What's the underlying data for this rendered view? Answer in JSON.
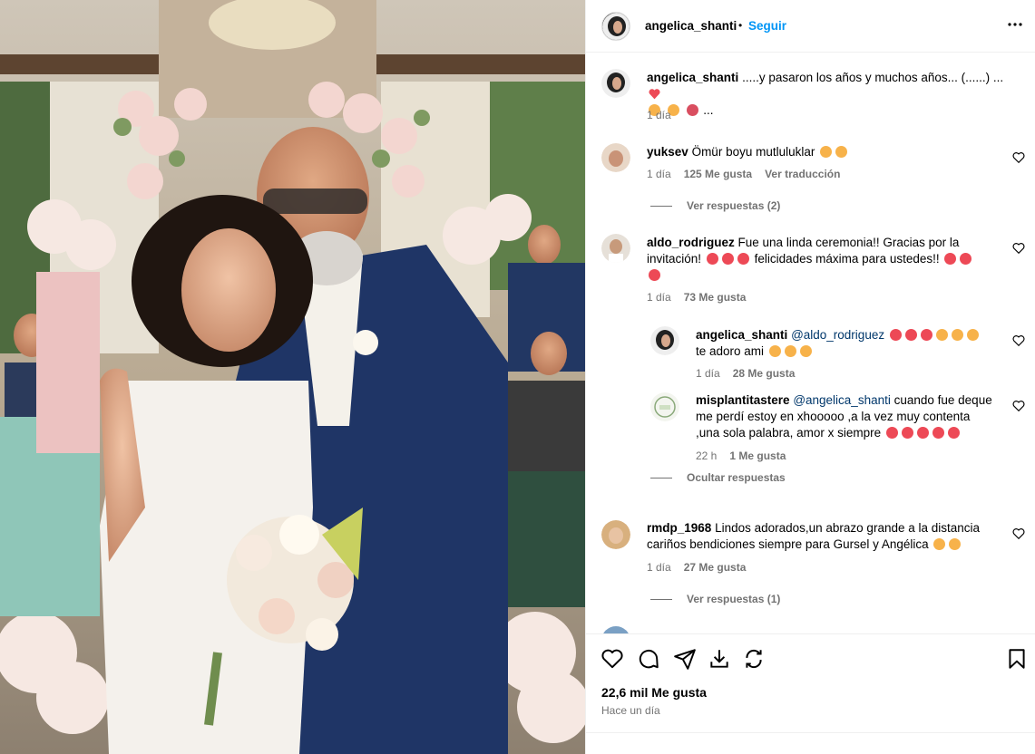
{
  "post": {
    "username": "angelica_shanti",
    "follow_label": "Seguir",
    "separator": "•",
    "more_label": "•••"
  },
  "caption": {
    "username": "angelica_shanti",
    "text": ".....y pasaron los años y muchos años... (......) ...",
    "time": "1 día"
  },
  "comments": [
    {
      "username": "yuksev",
      "text": "Ömür boyu mutluluklar",
      "time": "1 día",
      "likes": "125 Me gusta",
      "translate": "Ver traducción",
      "replies": "Ver respuestas (2)"
    },
    {
      "username": "aldo_rodriguez",
      "text_line1": "Fue una linda ceremonia!! Gracias por la",
      "text_line2": "invitación!",
      "text_line2b": "felicidades máxima para ustedes!!",
      "time": "1 día",
      "likes": "73 Me gusta"
    },
    {
      "username": "angelica_shanti",
      "mention": "@aldo_rodriguez",
      "text_line2": "te adoro ami",
      "time": "1 día",
      "likes": "28 Me gusta"
    },
    {
      "username": "misplantitastere",
      "mention": "@angelica_shanti",
      "text_line1": "cuando fue deque",
      "text_line2": "me perdí estoy en xhooooo ,a la vez muy contenta",
      "text_line3": ",una sola palabra, amor x siempre",
      "time": "22 h",
      "likes": "1 Me gusta",
      "hide": "Ocultar respuestas"
    },
    {
      "username": "rmdp_1968",
      "text_line1": "Lindos adorados,un abrazo grande a la distancia",
      "text_line2": "cariños bendiciones siempre para Gursel y Angélica",
      "time": "1 día",
      "likes": "27 Me gusta",
      "replies": "Ver respuestas (1)"
    }
  ],
  "footer": {
    "likes": "22,6 mil Me gusta",
    "ago": "Hace un día"
  },
  "colors": {
    "accent": "#0095f6",
    "heart": "#ed4956",
    "muted": "#737373"
  }
}
